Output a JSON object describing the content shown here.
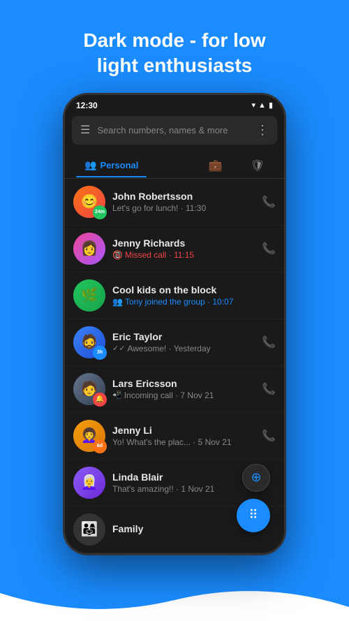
{
  "header": {
    "title_line1": "Dark mode - for low",
    "title_line2": "light enthusiasts"
  },
  "status_bar": {
    "time": "12:30",
    "icons": "▲ 4 ■"
  },
  "search": {
    "placeholder": "Search numbers, names & more"
  },
  "tabs": [
    {
      "id": "personal",
      "label": "Personal",
      "icon": "👥",
      "active": true
    },
    {
      "id": "business",
      "label": "",
      "icon": "💼",
      "active": false
    },
    {
      "id": "shield",
      "label": "",
      "icon": "🛡",
      "active": false
    }
  ],
  "contacts": [
    {
      "id": "john",
      "name": "John Robertsson",
      "preview": "Let's go for lunch! · 11:30",
      "preview_type": "normal",
      "badge": "24m",
      "badge_type": "green",
      "has_call_icon": true,
      "avatar_emoji": "😊"
    },
    {
      "id": "jenny-r",
      "name": "Jenny Richards",
      "preview": "Missed call · 11:15",
      "preview_type": "missed",
      "badge": "",
      "badge_type": "",
      "has_call_icon": true,
      "avatar_emoji": "👩"
    },
    {
      "id": "cool-kids",
      "name": "Cool kids on the block",
      "preview": "Tony joined the group · 10:07",
      "preview_type": "group",
      "badge": "",
      "badge_type": "",
      "has_call_icon": false,
      "avatar_emoji": "🌿"
    },
    {
      "id": "eric",
      "name": "Eric Taylor",
      "preview": "Awesome! · Yesterday",
      "preview_type": "normal",
      "badge": "3h",
      "badge_type": "blue",
      "has_call_icon": true,
      "avatar_emoji": "🧔"
    },
    {
      "id": "lars",
      "name": "Lars Ericsson",
      "preview": "Incoming call · 7 Nov 21",
      "preview_type": "incoming",
      "badge": "",
      "badge_type": "",
      "has_call_icon": true,
      "avatar_emoji": "👨"
    },
    {
      "id": "jenny-l",
      "name": "Jenny Li",
      "preview": "Yo! What's the plac... · 5 Nov 21",
      "preview_type": "normal",
      "badge": "6d",
      "badge_type": "orange",
      "has_call_icon": true,
      "avatar_emoji": "👩‍🦱"
    },
    {
      "id": "linda",
      "name": "Linda Blair",
      "preview": "That's amazing!! · 1 Nov 21",
      "preview_type": "normal",
      "badge": "",
      "badge_type": "",
      "has_call_icon": false,
      "avatar_emoji": "👩‍🦳"
    },
    {
      "id": "family",
      "name": "Family",
      "preview": "",
      "preview_type": "normal",
      "badge": "",
      "badge_type": "",
      "has_call_icon": false,
      "avatar_emoji": "👨‍👩‍👧"
    }
  ],
  "fabs": {
    "add_label": "⊕",
    "dialpad_label": "⠿"
  }
}
